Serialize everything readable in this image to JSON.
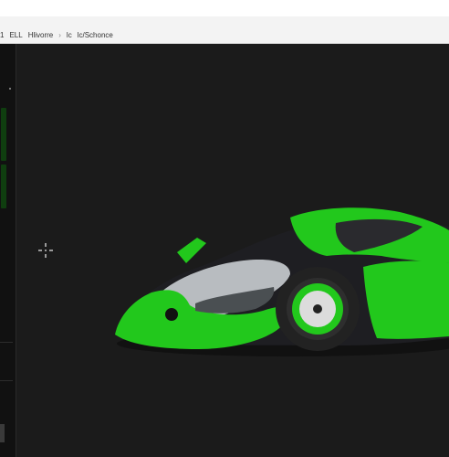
{
  "window": {
    "breadcrumb": [
      "1",
      "ELL",
      "Hlivorre",
      "lc",
      "lc/Schonce"
    ]
  },
  "viewer": {
    "subject": "green-sports-car",
    "colors": {
      "background": "#1b1b1b",
      "body_green": "#22c81c",
      "body_dark": "#1e1e22",
      "body_silver": "#b8bcc0"
    }
  }
}
